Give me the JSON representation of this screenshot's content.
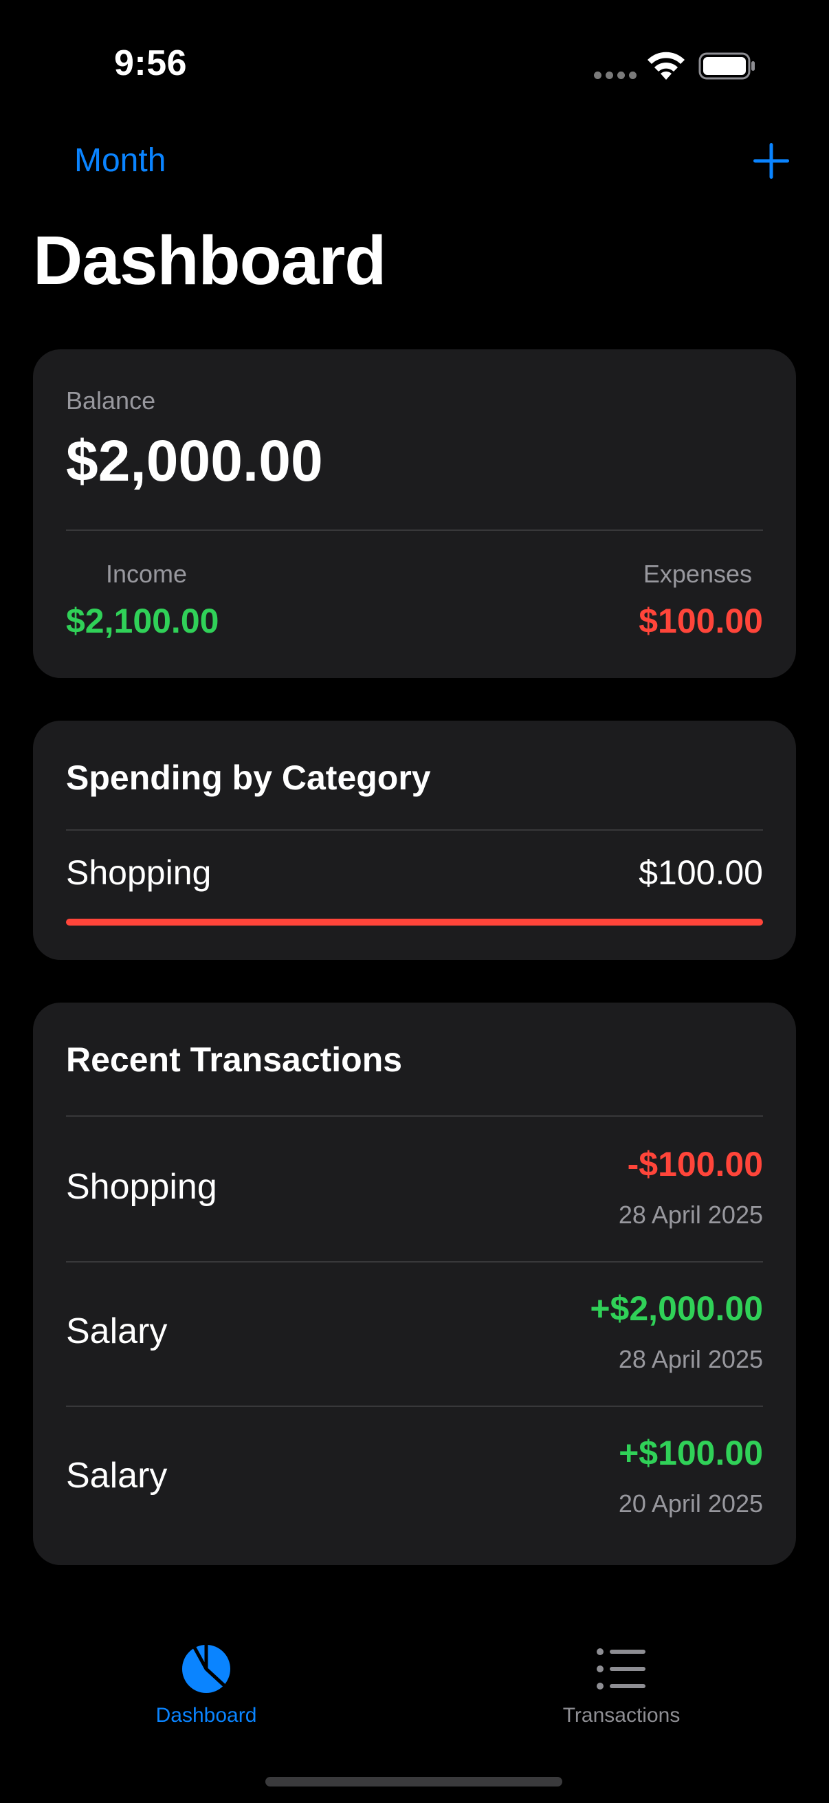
{
  "status_bar": {
    "time": "9:56"
  },
  "nav": {
    "month_label": "Month",
    "title": "Dashboard"
  },
  "summary": {
    "balance_label": "Balance",
    "balance_value": "$2,000.00",
    "income_label": "Income",
    "income_value": "$2,100.00",
    "expenses_label": "Expenses",
    "expenses_value": "$100.00"
  },
  "spending": {
    "title": "Spending by Category",
    "items": [
      {
        "category": "Shopping",
        "amount": "$100.00",
        "share": 1.0
      }
    ]
  },
  "recent": {
    "title": "Recent Transactions",
    "items": [
      {
        "name": "Shopping",
        "amount": "-$100.00",
        "date": "28 April 2025",
        "type": "expense"
      },
      {
        "name": "Salary",
        "amount": "+$2,000.00",
        "date": "28 April 2025",
        "type": "income"
      },
      {
        "name": "Salary",
        "amount": "+$100.00",
        "date": "20 April 2025",
        "type": "income"
      }
    ]
  },
  "tab_bar": {
    "items": [
      {
        "label": "Dashboard",
        "icon": "pie-chart-icon",
        "active": true
      },
      {
        "label": "Transactions",
        "icon": "list-icon",
        "active": false
      }
    ]
  },
  "colors": {
    "accent": "#0A84FF",
    "income": "#30D158",
    "expense": "#FF453A",
    "card": "#1C1C1E",
    "background": "#000000"
  }
}
